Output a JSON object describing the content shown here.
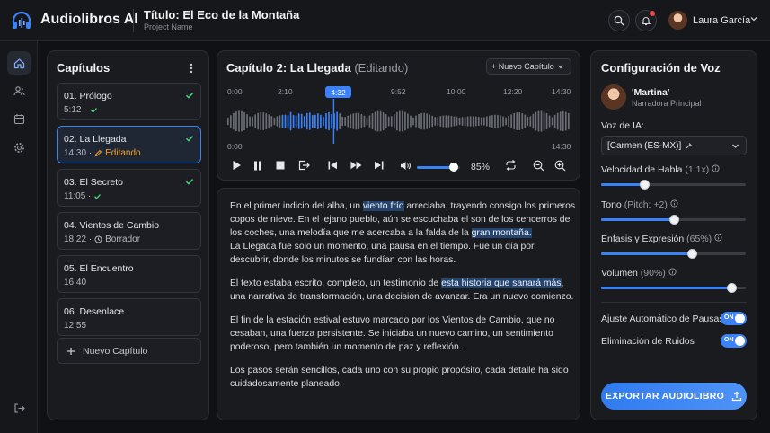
{
  "app": {
    "brand": "Audiolibros AI",
    "title": "Título: El Eco de la Montaña",
    "subtitle": "Project Name",
    "user_name": "Laura García"
  },
  "chapters": {
    "heading": "Capítulos",
    "items": [
      {
        "name": "01. Prólogo",
        "duration": "5:12 ·",
        "status": "done"
      },
      {
        "name": "02. La Llegada",
        "duration": "14:30 ·",
        "status_text": "Editando",
        "status": "editing"
      },
      {
        "name": "03. El Secreto",
        "duration": "11:05 ·",
        "status": "done"
      },
      {
        "name": "04. Vientos de Cambio",
        "duration": "18:22 ·",
        "status_text": "Borrador",
        "status": "draft"
      },
      {
        "name": "05. El Encuentro",
        "duration": "16:40",
        "status": "none"
      },
      {
        "name": "06. Desenlace",
        "duration": "12:55",
        "status": "none"
      }
    ],
    "new_label": "Nuevo Capítulo"
  },
  "editor": {
    "title": "Capítulo 2: La Llegada",
    "mode": "(Editando)",
    "new_button": "+ Nuevo Capítulo",
    "timeline_labels": [
      "0:00",
      "2:10",
      "4:32",
      "9:52",
      "10:00",
      "12:20",
      "14:30"
    ],
    "playhead": "4:32",
    "start_label": "0:00",
    "end_label": "14:30",
    "volume_pct": "85%",
    "volume_level": 0.85,
    "progress_fraction": 0.31
  },
  "text": {
    "p1_a": "En el primer indicio del alba, un ",
    "p1_hl1": "viento frío",
    "p1_b": " arreciaba, trayendo consigo los primeros copos de nieve. En el lejano pueblo, aún se escuchaba el son de los cencerros de los coches, una melodía que me acercaba a la falda de la ",
    "p1_hl2": "gran montaña.",
    "p1_c": "La Llegada fue solo un momento, una pausa en el tiempo. Fue un día por descubrir, donde los minutos se fundían con las horas.",
    "p2_a": "El texto estaba escrito, completo, un testimonio de ",
    "p2_hl": "esta historia que sanará más",
    "p2_b": ", una narrativa de transformación, una decisión de avanzar. Era un nuevo comienzo.",
    "p3": "El fin de la estación estival estuvo marcado por los Vientos de Cambio, que no cesaban, una fuerza persistente. Se iniciaba un nuevo camino, un sentimiento poderoso, pero también un momento de paz y reflexión.",
    "p4": "Los pasos serán sencillos, cada uno con su propio propósito, cada detalle ha sido cuidadosamente planeado."
  },
  "voice": {
    "heading": "Configuración de Voz",
    "name": "'Martina'",
    "role": "Narradora Principal",
    "ai_label": "Voz de IA:",
    "ai_value": "[Carmen (ES-MX)]",
    "speed_label": "Velocidad de Habla",
    "speed_value": "(1.1x)",
    "speed_level": 0.3,
    "tone_label": "Tono",
    "tone_value": "(Pitch: +2)",
    "tone_level": 0.5,
    "emphasis_label": "Énfasis y Expresión",
    "emphasis_value": "(65%)",
    "emphasis_level": 0.63,
    "volume_label": "Volumen",
    "volume_value": "(90%)",
    "volume_level": 0.9,
    "pause_label": "Ajuste Automático de Pausas",
    "noise_label": "Eliminación de Ruidos",
    "toggle_on": "ON",
    "export_label": "EXPORTAR AUDIOLIBRO"
  },
  "colors": {
    "accent": "#3b82f6",
    "edit": "#f0a030",
    "check": "#4ade80"
  }
}
